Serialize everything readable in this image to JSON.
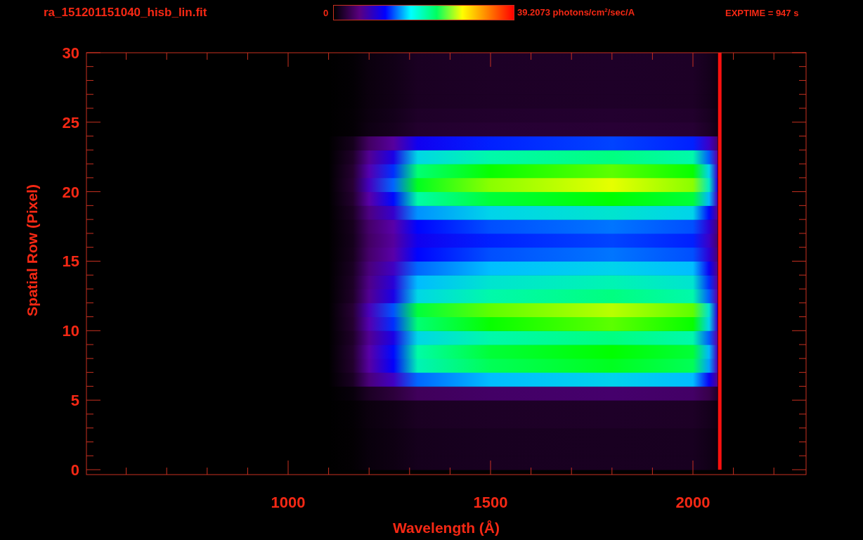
{
  "header": {
    "file_name": "ra_151201151040_hisb_lin.fit",
    "colorbar": {
      "min_label": "0",
      "max_label": "39.2073 photons/cm$^{2}$/sec/A"
    },
    "exposure": "EXPTIME = 947 s"
  },
  "plot": {
    "xlabel": "Wavelength (Å)",
    "ylabel": "Spatial Row (Pixel)",
    "xtick_labels": [
      "1000",
      "1500",
      "2000"
    ],
    "ytick_labels": [
      "30",
      "25",
      "20",
      "15",
      "10",
      "5",
      "0"
    ]
  }
}
